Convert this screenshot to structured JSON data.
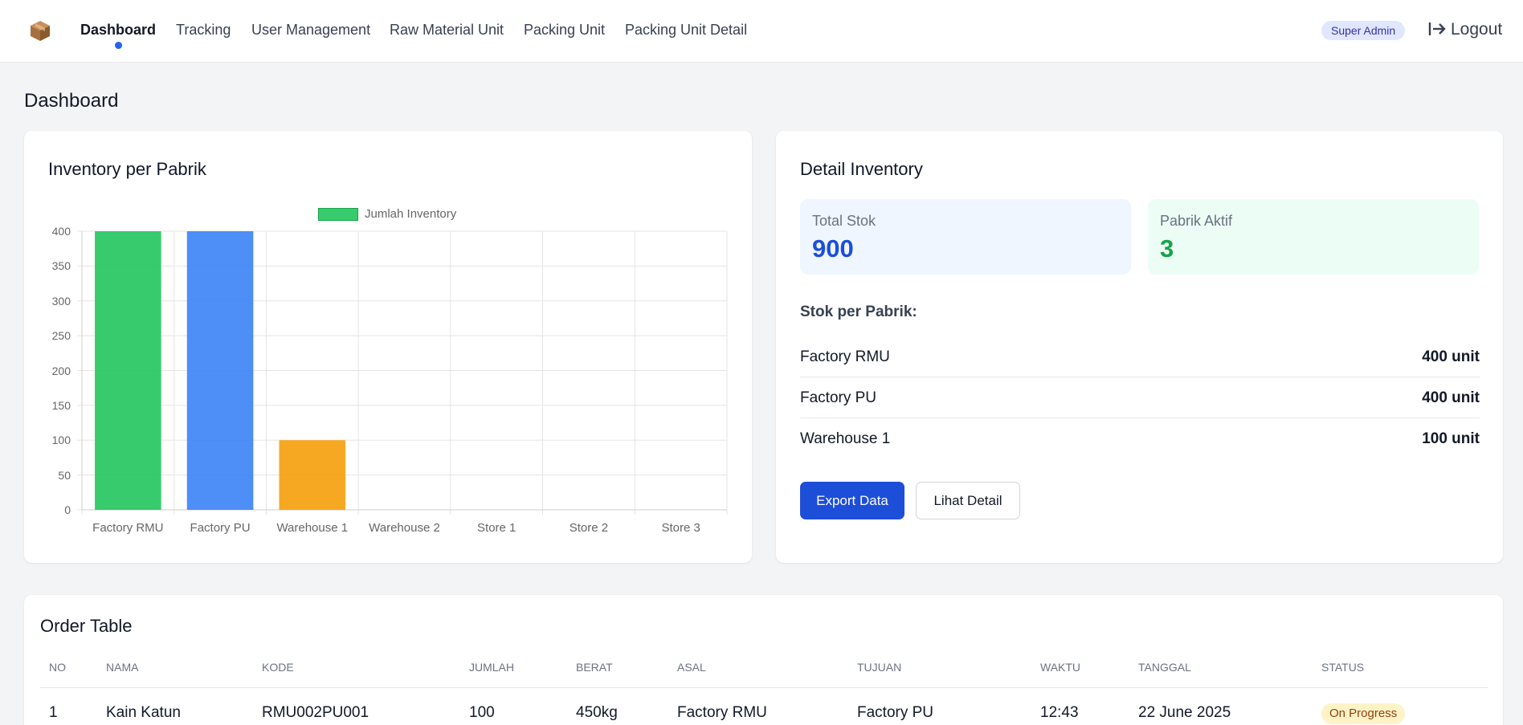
{
  "nav": {
    "items": [
      {
        "label": "Dashboard",
        "active": true
      },
      {
        "label": "Tracking",
        "active": false
      },
      {
        "label": "User Management",
        "active": false
      },
      {
        "label": "Raw Material Unit",
        "active": false
      },
      {
        "label": "Packing Unit",
        "active": false
      },
      {
        "label": "Packing Unit Detail",
        "active": false
      }
    ],
    "role_badge": "Super Admin",
    "logout_label": "Logout",
    "logo_icon": "box-icon",
    "logout_icon": "logout-arrow-icon"
  },
  "page_title": "Dashboard",
  "inventory_card": {
    "title": "Inventory per Pabrik"
  },
  "chart_data": {
    "type": "bar",
    "categories": [
      "Factory RMU",
      "Factory PU",
      "Warehouse 1",
      "Warehouse 2",
      "Store 1",
      "Store 2",
      "Store 3"
    ],
    "series": [
      {
        "name": "Jumlah Inventory",
        "values": [
          400,
          400,
          100,
          0,
          0,
          0,
          0
        ]
      }
    ],
    "colors": [
      "#22c55e",
      "#3b82f6",
      "#f59e0b",
      "#ef4444",
      "#8b5cf6",
      "#06b6d4",
      "#ec4899"
    ],
    "ylim": [
      0,
      400
    ],
    "yticks": [
      0,
      50,
      100,
      150,
      200,
      250,
      300,
      350,
      400
    ],
    "grid": true,
    "legend": "top-center"
  },
  "detail_card": {
    "title": "Detail Inventory",
    "total_stok": {
      "label": "Total Stok",
      "value": "900",
      "color": "#1d4ed8",
      "bg": "#eff6ff"
    },
    "pabrik_aktif": {
      "label": "Pabrik Aktif",
      "value": "3",
      "color": "#16a34a",
      "bg": "#ecfdf5"
    },
    "subtitle": "Stok per Pabrik:",
    "rows": [
      {
        "name": "Factory RMU",
        "value": "400 unit"
      },
      {
        "name": "Factory PU",
        "value": "400 unit"
      },
      {
        "name": "Warehouse 1",
        "value": "100 unit"
      }
    ],
    "export_label": "Export Data",
    "detail_label": "Lihat Detail"
  },
  "order_table": {
    "title": "Order Table",
    "headers": [
      "NO",
      "NAMA",
      "KODE",
      "JUMLAH",
      "BERAT",
      "ASAL",
      "TUJUAN",
      "WAKTU",
      "TANGGAL",
      "STATUS"
    ],
    "rows": [
      {
        "no": "1",
        "nama": "Kain Katun",
        "kode": "RMU002PU001",
        "jumlah": "100",
        "berat": "450kg",
        "asal": "Factory RMU",
        "tujuan": "Factory PU",
        "waktu": "12:43",
        "tanggal": "22 June 2025",
        "status": "On Progress"
      }
    ]
  }
}
